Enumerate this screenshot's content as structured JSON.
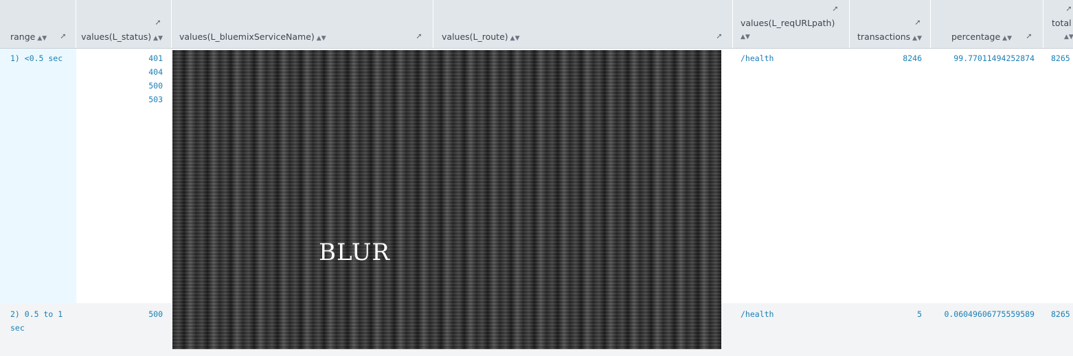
{
  "columns": [
    {
      "label": "range"
    },
    {
      "label": "values(L_status)"
    },
    {
      "label": "values(L_bluemixServiceName)"
    },
    {
      "label": "values(L_route)"
    },
    {
      "label": "values(L_reqURLpath)"
    },
    {
      "label": "transactions"
    },
    {
      "label": "percentage"
    },
    {
      "label": "total"
    }
  ],
  "rows": [
    {
      "range_line1": "1) <0.5 sec",
      "range_line2": "",
      "status": [
        "401",
        "404",
        "500",
        "503"
      ],
      "reqURLpath": "/health",
      "transactions": "8246",
      "percentage": "99.77011494252874",
      "total": "8265"
    },
    {
      "range_line1": "2) 0.5 to 1",
      "range_line2": "sec",
      "status": [
        "500"
      ],
      "reqURLpath": "/health",
      "transactions": "5",
      "percentage": "0.06049606775559589",
      "total": "8265"
    }
  ],
  "redaction": {
    "label": "BLUR"
  },
  "icons": {
    "sort": "sort-icon",
    "resize": "resize-icon"
  },
  "colors": {
    "header_bg": "#e1e6eb",
    "value_text": "#1a7eb5",
    "selected_cell": "#ecf8ff"
  }
}
